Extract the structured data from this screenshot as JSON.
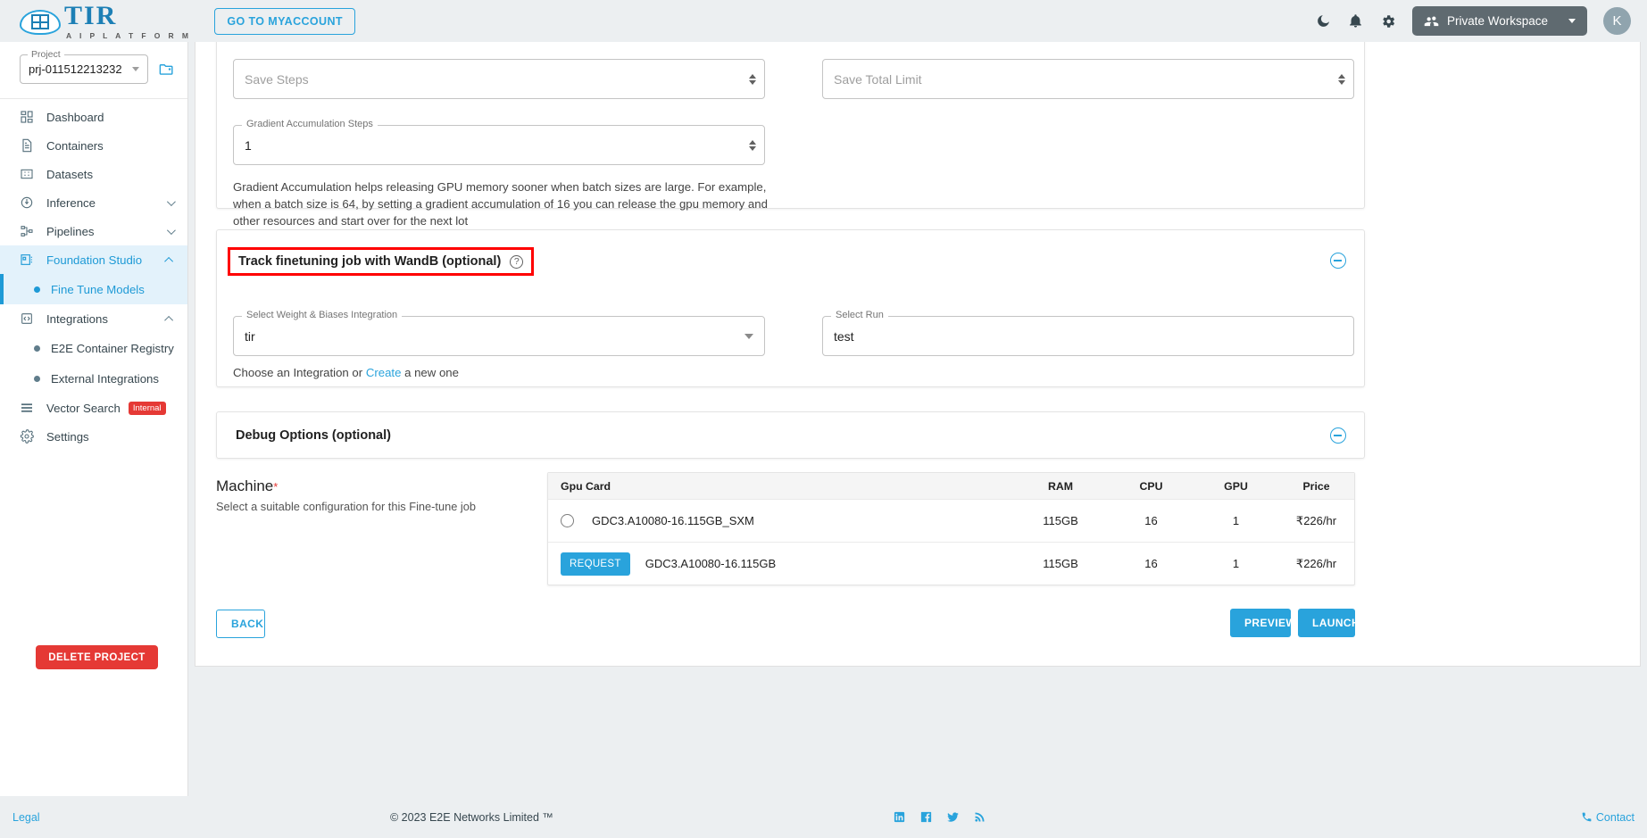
{
  "topbar": {
    "brand_name": "TIR",
    "brand_tagline": "A I   P L A T F O R M",
    "myaccount_label": "GO TO MYACCOUNT",
    "workspace_label": "Private Workspace",
    "avatar_initial": "K",
    "icons": {
      "dark_mode": "moon-icon",
      "notifications": "bell-icon",
      "settings": "gear-icon"
    }
  },
  "sidebar": {
    "project_legend": "Project",
    "project_value": "prj-011512213232",
    "items": [
      {
        "label": "Dashboard",
        "icon": "dashboard-icon",
        "expandable": false,
        "active": false
      },
      {
        "label": "Containers",
        "icon": "document-icon",
        "expandable": false,
        "active": false
      },
      {
        "label": "Datasets",
        "icon": "grid-icon",
        "expandable": false,
        "active": false
      },
      {
        "label": "Inference",
        "icon": "inference-icon",
        "expandable": true,
        "expanded": false,
        "active": false
      },
      {
        "label": "Pipelines",
        "icon": "pipeline-icon",
        "expandable": true,
        "expanded": false,
        "active": false
      },
      {
        "label": "Foundation Studio",
        "icon": "studio-icon",
        "expandable": true,
        "expanded": true,
        "active": true
      },
      {
        "label": "Integrations",
        "icon": "code-icon",
        "expandable": true,
        "expanded": true,
        "active": false
      },
      {
        "label": "Vector Search",
        "icon": "list-icon",
        "expandable": false,
        "active": false,
        "badge": "Internal"
      },
      {
        "label": "Settings",
        "icon": "gear-icon",
        "expandable": false,
        "active": false
      }
    ],
    "sub_fine_tune": "Fine Tune Models",
    "sub_e2e_registry": "E2E Container Registry",
    "sub_external_integrations": "External Integrations",
    "delete_project_label": "DELETE PROJECT"
  },
  "form": {
    "save_steps": {
      "legend": "Save Steps",
      "value": "",
      "placeholder": "Save Steps"
    },
    "save_total_limit": {
      "legend": "Save Total Limit",
      "value": "",
      "placeholder": "Save Total Limit"
    },
    "gradient_accumulation": {
      "legend": "Gradient Accumulation Steps",
      "value": "1"
    },
    "gradient_helper": "Gradient Accumulation helps releasing GPU memory sooner when batch sizes are large. For example, when a batch size is 64, by setting a gradient accumulation of 16 you can release the gpu memory and other resources and start over for the next lot"
  },
  "wandb": {
    "section_title": "Track finetuning job with WandB (optional)",
    "help_icon": "question-circle-icon",
    "integration_legend": "Select Weight & Biases Integration",
    "integration_value": "tir",
    "run_legend": "Select Run",
    "run_value": "test",
    "helper_prefix": "Choose an Integration or ",
    "helper_link": "Create",
    "helper_suffix": " a new one"
  },
  "debug": {
    "section_title": "Debug Options (optional)"
  },
  "machine": {
    "title": "Machine",
    "required_mark": "*",
    "subtitle": "Select a suitable configuration for this Fine-tune job",
    "columns": [
      "Gpu Card",
      "RAM",
      "CPU",
      "GPU",
      "Price"
    ],
    "rows": [
      {
        "selector": "radio",
        "name": "GDC3.A10080-16.115GB_SXM",
        "ram": "115GB",
        "cpu": "16",
        "gpu": "1",
        "price": "₹226/hr"
      },
      {
        "selector": "request",
        "request_label": "REQUEST",
        "name": "GDC3.A10080-16.115GB",
        "ram": "115GB",
        "cpu": "16",
        "gpu": "1",
        "price": "₹226/hr"
      }
    ]
  },
  "actions": {
    "back": "BACK",
    "preview": "PREVIEW",
    "launch": "LAUNCH"
  },
  "footer": {
    "legal": "Legal",
    "copyright": "© 2023 E2E Networks Limited ™",
    "contact": "Contact",
    "social": [
      "linkedin-icon",
      "facebook-icon",
      "twitter-icon",
      "rss-icon"
    ]
  },
  "colors": {
    "accent": "#29a3dc",
    "danger": "#e53935",
    "highlight": "#ff0000",
    "sidebar_active_bg": "#e3f2fb"
  }
}
